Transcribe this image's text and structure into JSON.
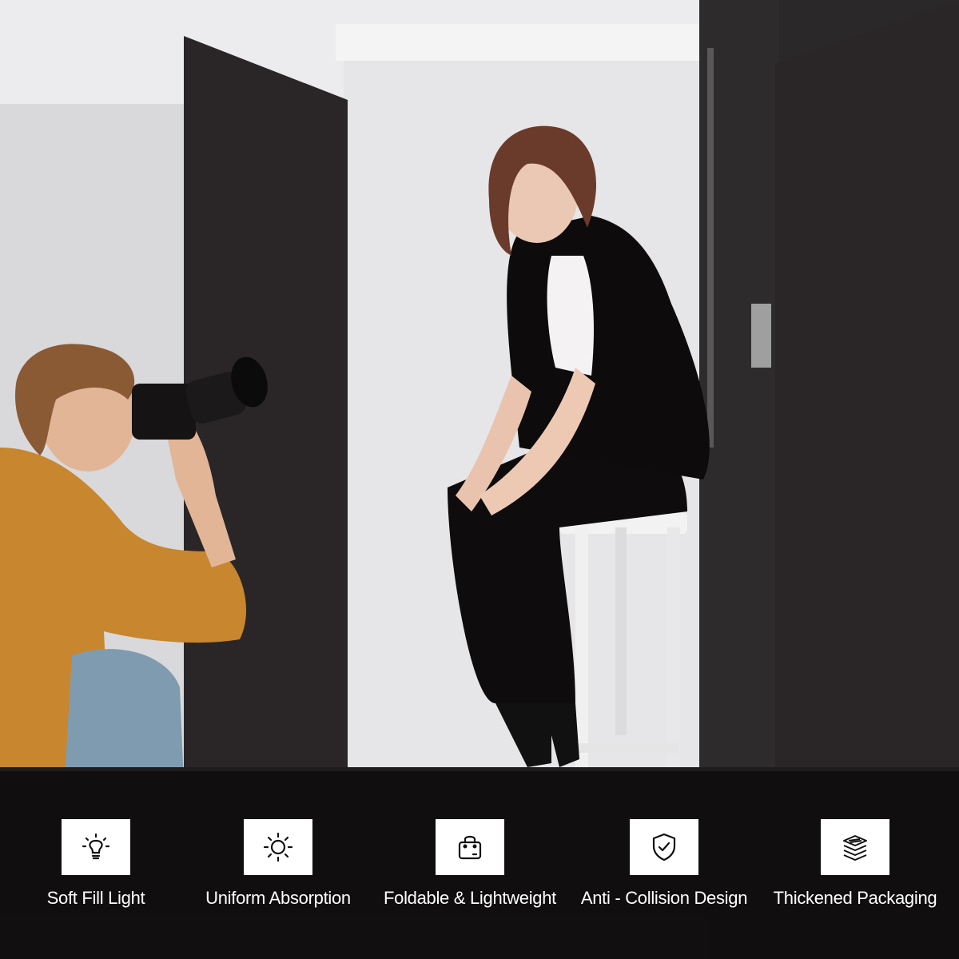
{
  "features": [
    {
      "label": "Soft Fill Light",
      "icon": "lightbulb-icon"
    },
    {
      "label": "Uniform Absorption",
      "icon": "sun-icon"
    },
    {
      "label": "Foldable & Lightweight",
      "icon": "bag-icon"
    },
    {
      "label": "Anti - Collision Design",
      "icon": "shield-check-icon"
    },
    {
      "label": "Thickened Packaging",
      "icon": "layers-icon"
    }
  ],
  "colors": {
    "backdrop": "#e4e4e6",
    "panel": "#2a2627",
    "shirt": "#c8862e",
    "bar": "#0c0a0a",
    "icon_bg": "#ffffff"
  }
}
